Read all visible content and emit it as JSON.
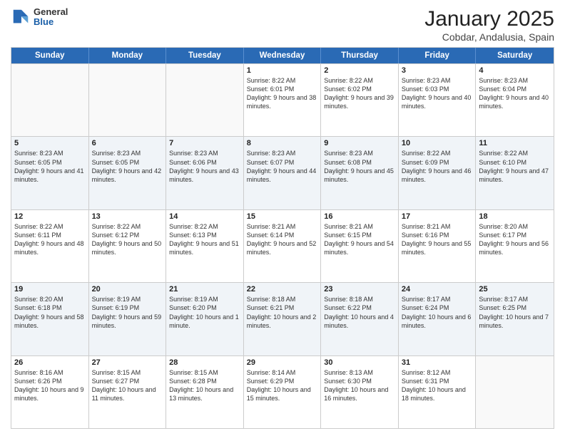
{
  "header": {
    "logo": {
      "general": "General",
      "blue": "Blue"
    },
    "title": "January 2025",
    "location": "Cobdar, Andalusia, Spain"
  },
  "weekdays": [
    "Sunday",
    "Monday",
    "Tuesday",
    "Wednesday",
    "Thursday",
    "Friday",
    "Saturday"
  ],
  "weeks": [
    [
      {
        "day": "",
        "info": ""
      },
      {
        "day": "",
        "info": ""
      },
      {
        "day": "",
        "info": ""
      },
      {
        "day": "1",
        "info": "Sunrise: 8:22 AM\nSunset: 6:01 PM\nDaylight: 9 hours\nand 38 minutes."
      },
      {
        "day": "2",
        "info": "Sunrise: 8:22 AM\nSunset: 6:02 PM\nDaylight: 9 hours\nand 39 minutes."
      },
      {
        "day": "3",
        "info": "Sunrise: 8:23 AM\nSunset: 6:03 PM\nDaylight: 9 hours\nand 40 minutes."
      },
      {
        "day": "4",
        "info": "Sunrise: 8:23 AM\nSunset: 6:04 PM\nDaylight: 9 hours\nand 40 minutes."
      }
    ],
    [
      {
        "day": "5",
        "info": "Sunrise: 8:23 AM\nSunset: 6:05 PM\nDaylight: 9 hours\nand 41 minutes."
      },
      {
        "day": "6",
        "info": "Sunrise: 8:23 AM\nSunset: 6:05 PM\nDaylight: 9 hours\nand 42 minutes."
      },
      {
        "day": "7",
        "info": "Sunrise: 8:23 AM\nSunset: 6:06 PM\nDaylight: 9 hours\nand 43 minutes."
      },
      {
        "day": "8",
        "info": "Sunrise: 8:23 AM\nSunset: 6:07 PM\nDaylight: 9 hours\nand 44 minutes."
      },
      {
        "day": "9",
        "info": "Sunrise: 8:23 AM\nSunset: 6:08 PM\nDaylight: 9 hours\nand 45 minutes."
      },
      {
        "day": "10",
        "info": "Sunrise: 8:22 AM\nSunset: 6:09 PM\nDaylight: 9 hours\nand 46 minutes."
      },
      {
        "day": "11",
        "info": "Sunrise: 8:22 AM\nSunset: 6:10 PM\nDaylight: 9 hours\nand 47 minutes."
      }
    ],
    [
      {
        "day": "12",
        "info": "Sunrise: 8:22 AM\nSunset: 6:11 PM\nDaylight: 9 hours\nand 48 minutes."
      },
      {
        "day": "13",
        "info": "Sunrise: 8:22 AM\nSunset: 6:12 PM\nDaylight: 9 hours\nand 50 minutes."
      },
      {
        "day": "14",
        "info": "Sunrise: 8:22 AM\nSunset: 6:13 PM\nDaylight: 9 hours\nand 51 minutes."
      },
      {
        "day": "15",
        "info": "Sunrise: 8:21 AM\nSunset: 6:14 PM\nDaylight: 9 hours\nand 52 minutes."
      },
      {
        "day": "16",
        "info": "Sunrise: 8:21 AM\nSunset: 6:15 PM\nDaylight: 9 hours\nand 54 minutes."
      },
      {
        "day": "17",
        "info": "Sunrise: 8:21 AM\nSunset: 6:16 PM\nDaylight: 9 hours\nand 55 minutes."
      },
      {
        "day": "18",
        "info": "Sunrise: 8:20 AM\nSunset: 6:17 PM\nDaylight: 9 hours\nand 56 minutes."
      }
    ],
    [
      {
        "day": "19",
        "info": "Sunrise: 8:20 AM\nSunset: 6:18 PM\nDaylight: 9 hours\nand 58 minutes."
      },
      {
        "day": "20",
        "info": "Sunrise: 8:19 AM\nSunset: 6:19 PM\nDaylight: 9 hours\nand 59 minutes."
      },
      {
        "day": "21",
        "info": "Sunrise: 8:19 AM\nSunset: 6:20 PM\nDaylight: 10 hours\nand 1 minute."
      },
      {
        "day": "22",
        "info": "Sunrise: 8:18 AM\nSunset: 6:21 PM\nDaylight: 10 hours\nand 2 minutes."
      },
      {
        "day": "23",
        "info": "Sunrise: 8:18 AM\nSunset: 6:22 PM\nDaylight: 10 hours\nand 4 minutes."
      },
      {
        "day": "24",
        "info": "Sunrise: 8:17 AM\nSunset: 6:24 PM\nDaylight: 10 hours\nand 6 minutes."
      },
      {
        "day": "25",
        "info": "Sunrise: 8:17 AM\nSunset: 6:25 PM\nDaylight: 10 hours\nand 7 minutes."
      }
    ],
    [
      {
        "day": "26",
        "info": "Sunrise: 8:16 AM\nSunset: 6:26 PM\nDaylight: 10 hours\nand 9 minutes."
      },
      {
        "day": "27",
        "info": "Sunrise: 8:15 AM\nSunset: 6:27 PM\nDaylight: 10 hours\nand 11 minutes."
      },
      {
        "day": "28",
        "info": "Sunrise: 8:15 AM\nSunset: 6:28 PM\nDaylight: 10 hours\nand 13 minutes."
      },
      {
        "day": "29",
        "info": "Sunrise: 8:14 AM\nSunset: 6:29 PM\nDaylight: 10 hours\nand 15 minutes."
      },
      {
        "day": "30",
        "info": "Sunrise: 8:13 AM\nSunset: 6:30 PM\nDaylight: 10 hours\nand 16 minutes."
      },
      {
        "day": "31",
        "info": "Sunrise: 8:12 AM\nSunset: 6:31 PM\nDaylight: 10 hours\nand 18 minutes."
      },
      {
        "day": "",
        "info": ""
      }
    ]
  ]
}
